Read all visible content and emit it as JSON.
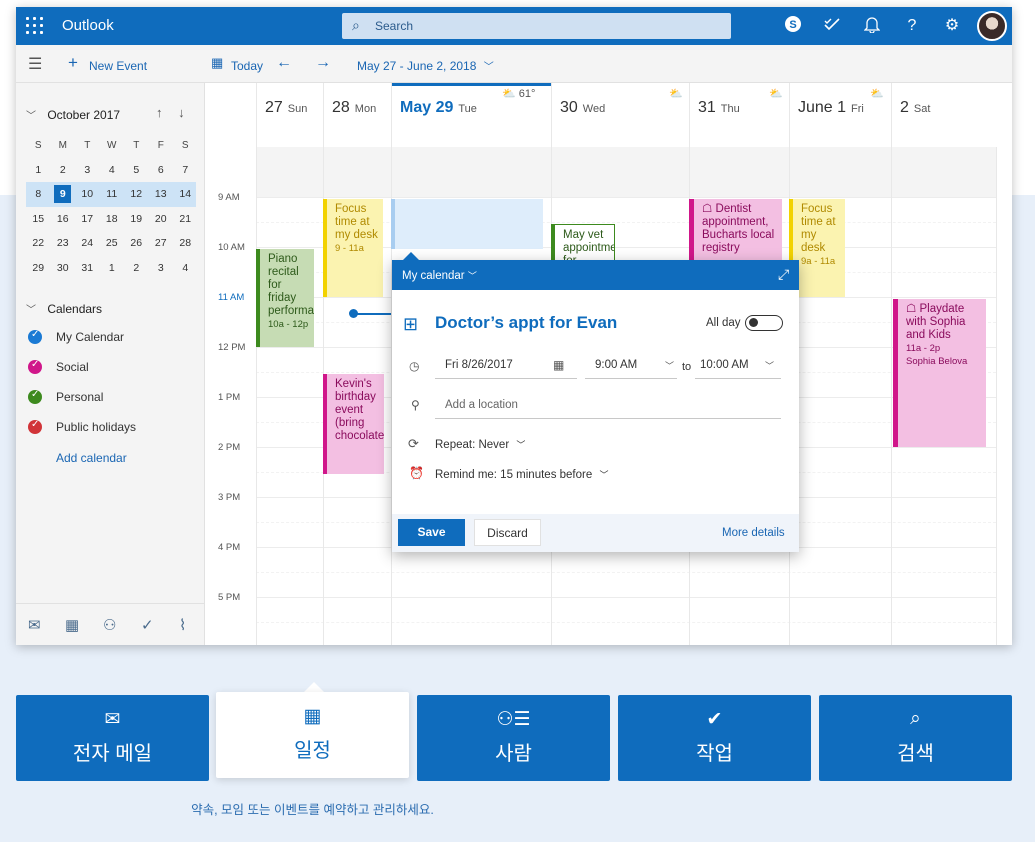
{
  "header": {
    "app_name": "Outlook",
    "search_placeholder": "Search",
    "icons": [
      "skype-icon",
      "todo-check-icon",
      "bell-icon",
      "help-icon",
      "gear-icon"
    ]
  },
  "toolbar": {
    "new_event": "New Event",
    "today": "Today",
    "date_range": "May 27 - June 2, 2018"
  },
  "mini_calendar": {
    "month": "October 2017",
    "weekdays": [
      "S",
      "M",
      "T",
      "W",
      "T",
      "F",
      "S"
    ],
    "weeks": [
      [
        "1",
        "2",
        "3",
        "4",
        "5",
        "6",
        "7"
      ],
      [
        "8",
        "9",
        "10",
        "11",
        "12",
        "13",
        "14"
      ],
      [
        "15",
        "16",
        "17",
        "18",
        "19",
        "20",
        "21"
      ],
      [
        "22",
        "23",
        "24",
        "25",
        "26",
        "27",
        "28"
      ],
      [
        "29",
        "30",
        "31",
        "1",
        "2",
        "3",
        "4"
      ]
    ],
    "selected_week_index": 1,
    "today": "9"
  },
  "calendars": {
    "heading": "Calendars",
    "items": [
      {
        "label": "My Calendar",
        "color": "#1a7ad4"
      },
      {
        "label": "Social",
        "color": "#d0168a"
      },
      {
        "label": "Personal",
        "color": "#3d8a1e"
      },
      {
        "label": "Public holidays",
        "color": "#d13438"
      }
    ],
    "add": "Add calendar"
  },
  "days": [
    {
      "num": "27",
      "name": "Sun"
    },
    {
      "num": "28",
      "name": "Mon"
    },
    {
      "num": "May 29",
      "name": "Tue",
      "weather": "61°"
    },
    {
      "num": "30",
      "name": "Wed"
    },
    {
      "num": "31",
      "name": "Thu"
    },
    {
      "num": "June 1",
      "name": "Fri"
    },
    {
      "num": "2",
      "name": "Sat"
    }
  ],
  "times": [
    "9 AM",
    "10 AM",
    "11 AM",
    "12 PM",
    "1 PM",
    "2 PM",
    "3 PM",
    "4 PM",
    "5 PM"
  ],
  "events": {
    "piano": {
      "title": "Piano recital for friday performance",
      "time": "10a - 12p"
    },
    "focus_mon": {
      "title": "Focus time at my desk",
      "time": "9 - 11a"
    },
    "kevin": {
      "title": "Kevin's birthday event (bring chocolate)"
    },
    "vet": {
      "title": "May vet appointment for"
    },
    "dentist": {
      "title": "Dentist appointment, Bucharts local registry"
    },
    "focus_fri": {
      "title": "Focus time at my desk",
      "time": "9a - 11a"
    },
    "playdate": {
      "title": "Playdate with Sophia and Kids",
      "time": "11a - 2p",
      "person": "Sophia Belova"
    }
  },
  "popup": {
    "calendar": "My calendar",
    "title": "Doctor’s appt for Evan",
    "all_day": "All day",
    "date": "Fri 8/26/2017",
    "start": "9:00 AM",
    "to": "to",
    "end": "10:00 AM",
    "location_placeholder": "Add a location",
    "repeat": "Repeat: Never",
    "remind": "Remind me: 15 minutes before",
    "save": "Save",
    "discard": "Discard",
    "more": "More details"
  },
  "tiles": [
    {
      "label": "전자 메일",
      "icon": "mail-icon"
    },
    {
      "label": "일정",
      "icon": "calendar-icon",
      "active": true
    },
    {
      "label": "사람",
      "icon": "people-icon"
    },
    {
      "label": "작업",
      "icon": "tasks-icon"
    },
    {
      "label": "검색",
      "icon": "search-icon"
    }
  ],
  "caption": "약속, 모임 또는 이벤트를 예약하고 관리하세요.",
  "colors": {
    "accent": "#0f6cbd",
    "background": "#e7eff9"
  }
}
